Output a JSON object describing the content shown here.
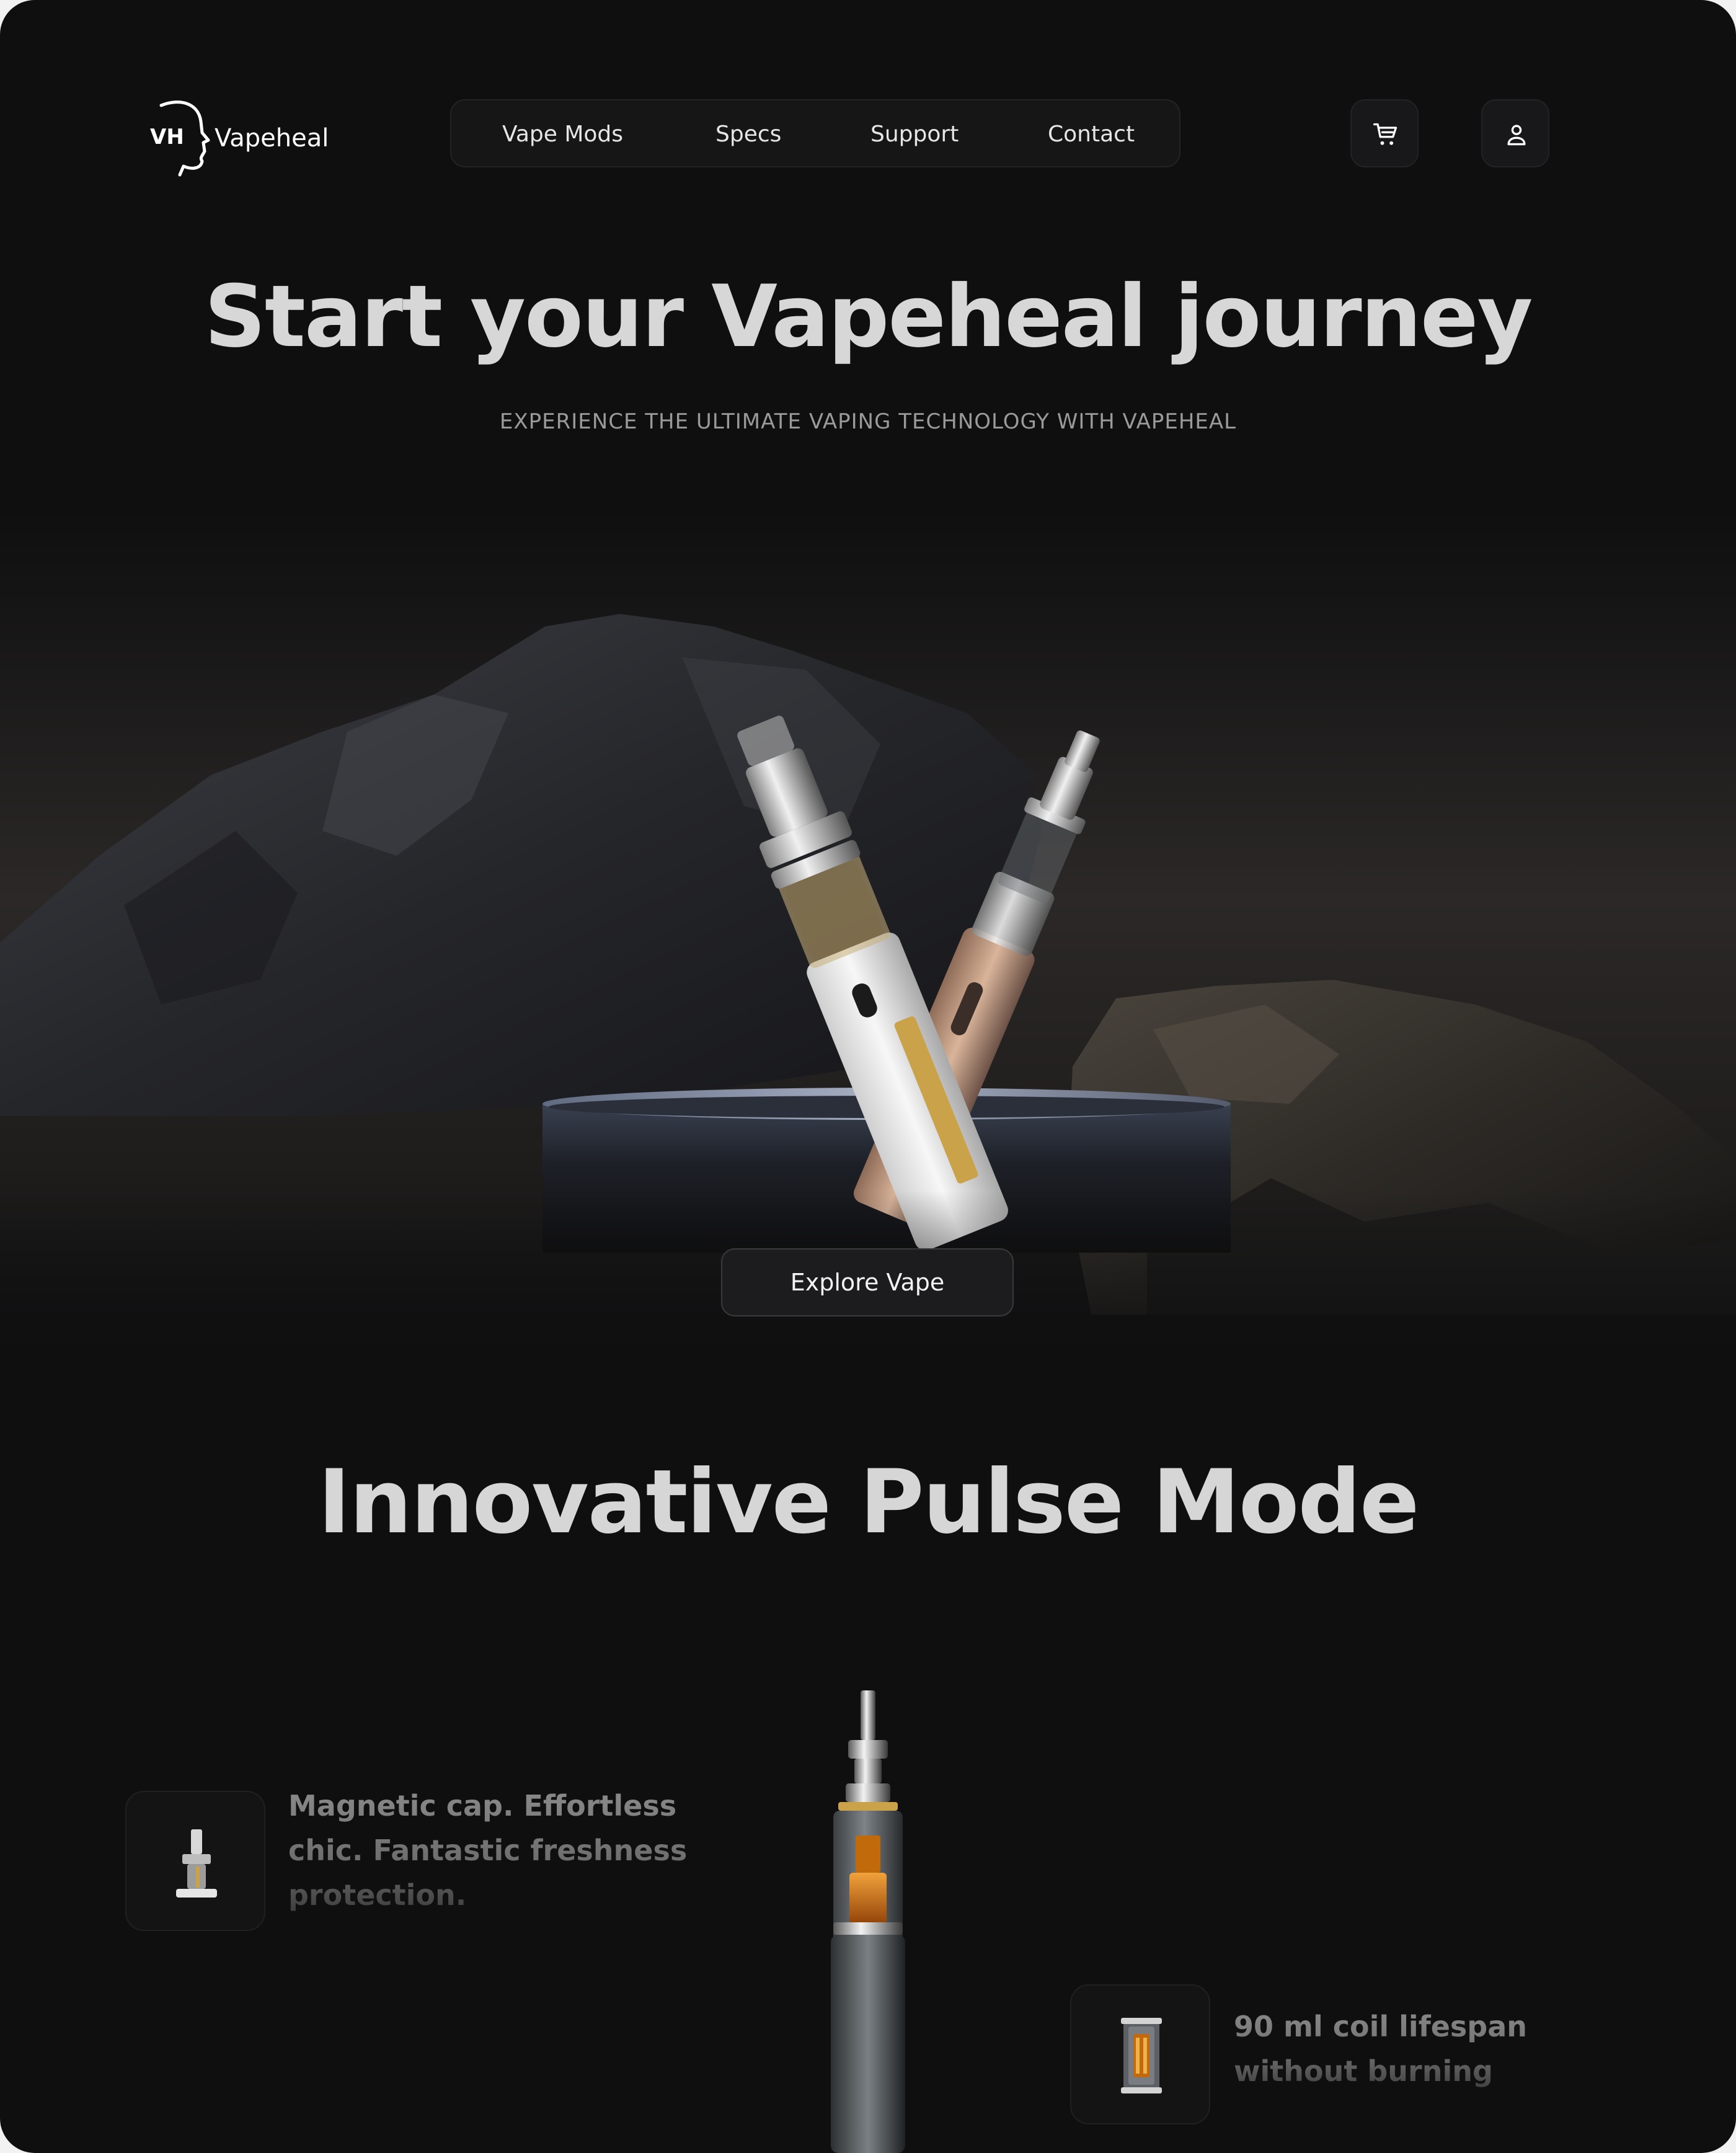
{
  "brand": {
    "logo_mark": "VH",
    "name": "Vapeheal"
  },
  "nav": {
    "items": [
      {
        "label": "Vape Mods"
      },
      {
        "label": "Specs"
      },
      {
        "label": "Support"
      },
      {
        "label": "Contact"
      }
    ]
  },
  "header_icons": {
    "cart": "cart-icon",
    "account": "user-icon"
  },
  "hero": {
    "title": "Start your Vapeheal journey",
    "subtitle": "EXPERIENCE THE ULTIMATE VAPING TECHNOLOGY WITH VAPEHEAL",
    "cta_label": "Explore Vape"
  },
  "pulse_section": {
    "title": "Innovative Pulse Mode",
    "features": [
      {
        "icon": "atomizer-cap-icon",
        "lines": [
          "Magnetic cap. Effortless",
          "chic. Fantastic freshness",
          "protection."
        ]
      },
      {
        "icon": "coil-icon",
        "lines": [
          "90 ml coil lifespan",
          "without burning"
        ]
      }
    ]
  },
  "colors": {
    "background": "#0f0f10",
    "accent_gold": "#c9a24a",
    "amber": "#d07a12",
    "text_primary": "#d7d7d7"
  }
}
